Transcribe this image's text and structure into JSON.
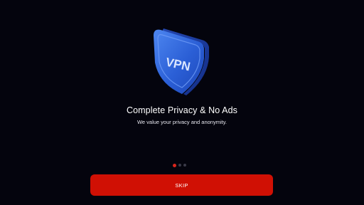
{
  "onboarding": {
    "illustration": {
      "icon": "vpn-shield-icon",
      "text": "VPN",
      "colors": {
        "front": "#2b5fd6",
        "highlight": "#4d86f0",
        "side": "#1c3c9e",
        "rim": "#5f92f5"
      }
    },
    "title": "Complete Privacy & No Ads",
    "subtitle": "We value your privacy and anonymity.",
    "pagination": {
      "current": 1,
      "total": 3,
      "active_color": "#d9261c",
      "inactive_color": "#3a3a48"
    },
    "skip_label": "SKIP",
    "accent": "#d01004",
    "background": "#04040d"
  }
}
